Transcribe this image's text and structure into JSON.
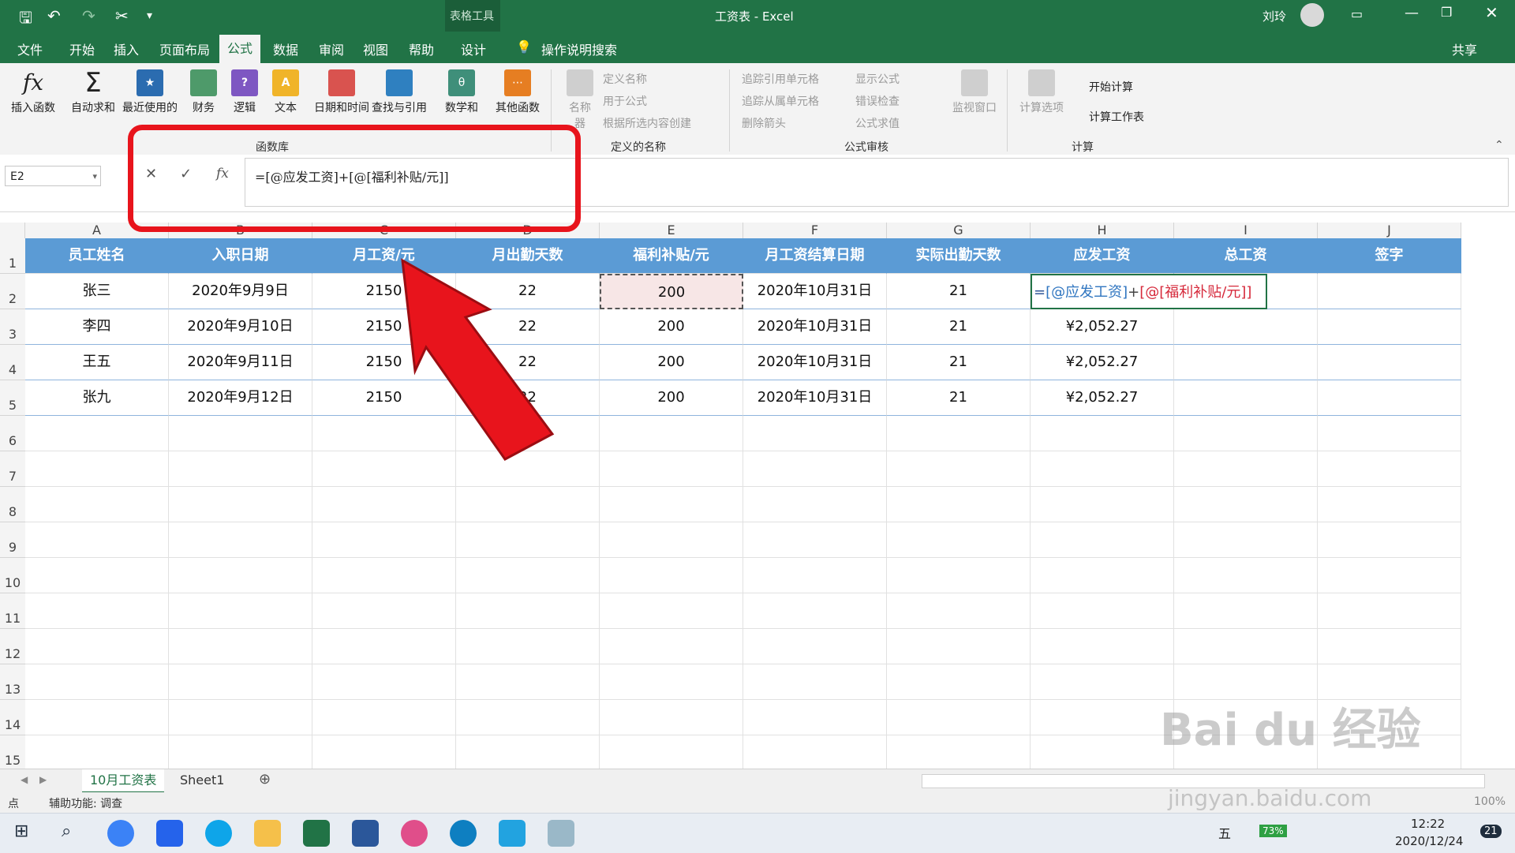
{
  "window": {
    "title": "工资表 - Excel",
    "context_tab_group": "表格工具",
    "user_name": "刘玲"
  },
  "tabs": [
    "文件",
    "开始",
    "插入",
    "页面布局",
    "公式",
    "数据",
    "审阅",
    "视图",
    "帮助",
    "设计"
  ],
  "active_tab": "公式",
  "tell_me": "操作说明搜索",
  "share": "共享",
  "ribbon": {
    "function_library": {
      "label": "函数库",
      "buttons": [
        "插入函数",
        "自动求和",
        "最近使用的",
        "财务",
        "逻辑",
        "文本",
        "日期和时间",
        "查找与引用",
        "数学和",
        "其他函数"
      ]
    },
    "defined_names": {
      "label": "定义的名称",
      "name_manager": "名称",
      "name_manager_sub": "器",
      "items": [
        "定义名称",
        "用于公式",
        "根据所选内容创建"
      ]
    },
    "formula_auditing": {
      "label": "公式审核",
      "items": [
        "追踪引用单元格",
        "追踪从属单元格",
        "删除箭头",
        "显示公式",
        "错误检查",
        "公式求值"
      ],
      "watch_window": "监视窗口"
    },
    "calculation": {
      "label": "计算",
      "calc_options": "计算选项",
      "items": [
        "开始计算",
        "计算工作表"
      ]
    }
  },
  "formula_bar": {
    "name_box": "E2",
    "formula": "=[@应发工资]+[@[福利补贴/元]]"
  },
  "columns": [
    "A",
    "B",
    "C",
    "D",
    "E",
    "F",
    "G",
    "H",
    "I",
    "J"
  ],
  "rows": [
    "1",
    "2",
    "3",
    "4",
    "5",
    "6",
    "7",
    "8",
    "9",
    "10",
    "11",
    "12",
    "13",
    "14",
    "15"
  ],
  "table": {
    "headers": [
      "员工姓名",
      "入职日期",
      "月工资/元",
      "月出勤天数",
      "福利补贴/元",
      "月工资结算日期",
      "实际出勤天数",
      "应发工资",
      "总工资",
      "签字"
    ],
    "data": [
      [
        "张三",
        "2020年9月9日",
        "2150",
        "22",
        "200",
        "2020年10月31日",
        "21",
        "",
        ""
      ],
      [
        "李四",
        "2020年9月10日",
        "2150",
        "22",
        "200",
        "2020年10月31日",
        "21",
        "¥2,052.27",
        ""
      ],
      [
        "王五",
        "2020年9月11日",
        "2150",
        "22",
        "200",
        "2020年10月31日",
        "21",
        "¥2,052.27",
        ""
      ],
      [
        "张九",
        "2020年9月12日",
        "2150",
        "22",
        "200",
        "2020年10月31日",
        "21",
        "¥2,052.27",
        ""
      ]
    ],
    "edit_cell": {
      "part1": "=",
      "part2": "[@应发工资]",
      "part3": "+",
      "part4": "[@[福利补贴/元]]"
    }
  },
  "sheets": [
    "10月工资表",
    "Sheet1"
  ],
  "active_sheet": "10月工资表",
  "status": {
    "mode": "点",
    "accessibility": "辅助功能: 调查",
    "zoom": "100%"
  },
  "taskbar": {
    "ime": "五",
    "battery": "73%",
    "time": "12:22",
    "date": "2020/12/24",
    "notifications": "21"
  },
  "watermark": {
    "logo": "Bai du 经验",
    "url": "jingyan.baidu.com"
  },
  "colors": {
    "excel_green": "#217346",
    "table_header": "#5b9bd5",
    "annotation_red": "#e8141c"
  }
}
